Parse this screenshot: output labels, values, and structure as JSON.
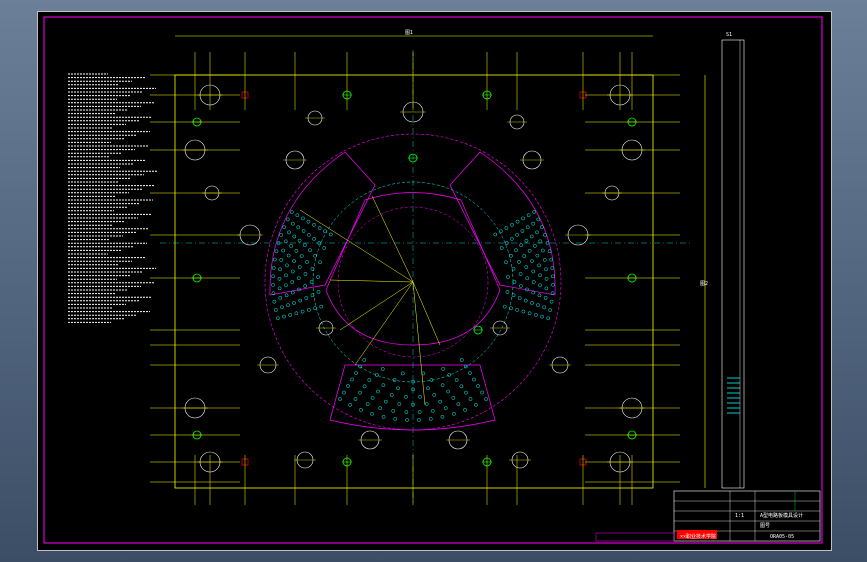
{
  "window": {
    "title": ""
  },
  "drawing": {
    "top_dimension": "图1",
    "side_dimension": "图2",
    "right_strip_label": "S1",
    "title_block": {
      "drawing_number": "ORA05-05",
      "name_line1": "A型电路板模具设计",
      "name_line2": "图号",
      "scale": "1:1",
      "company": "××职业技术学院"
    }
  },
  "colors": {
    "background": "#000000",
    "border": "#ff00ff",
    "main_lines": "#ffff00",
    "holes": "#00ffff",
    "markers": "#00ff00",
    "text": "#ffffff",
    "dashed": "#ff00ff",
    "stamp": "#ff0000"
  }
}
